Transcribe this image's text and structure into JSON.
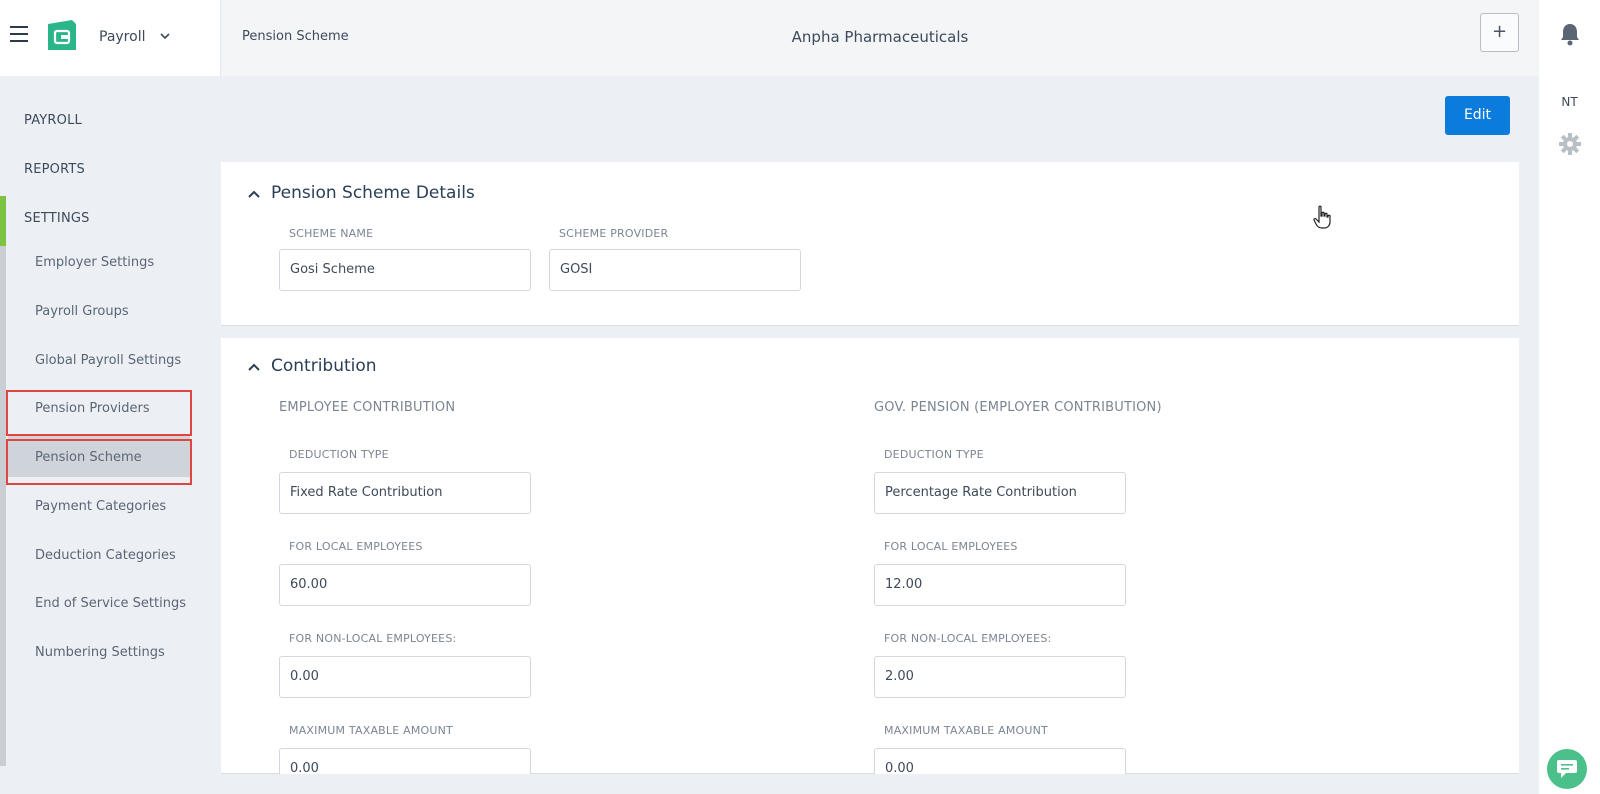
{
  "header": {
    "app_name": "Payroll",
    "breadcrumb": "Pension Scheme",
    "company": "Anpha Pharmaceuticals",
    "add_label": "+",
    "user_initials": "NT"
  },
  "sidebar": {
    "top_items": [
      {
        "label": "PAYROLL"
      },
      {
        "label": "REPORTS"
      },
      {
        "label": "SETTINGS"
      }
    ],
    "settings_items": [
      {
        "label": "Employer Settings"
      },
      {
        "label": "Payroll Groups"
      },
      {
        "label": "Global Payroll Settings"
      },
      {
        "label": "Pension Providers"
      },
      {
        "label": "Pension Scheme"
      },
      {
        "label": "Payment Categories"
      },
      {
        "label": "Deduction Categories"
      },
      {
        "label": "End of Service Settings"
      },
      {
        "label": "Numbering Settings"
      }
    ],
    "active_item": "Pension Scheme"
  },
  "actions": {
    "edit_label": "Edit"
  },
  "details": {
    "title": "Pension Scheme Details",
    "scheme_name_label": "SCHEME NAME",
    "scheme_name_value": "Gosi Scheme",
    "scheme_provider_label": "SCHEME PROVIDER",
    "scheme_provider_value": "GOSI"
  },
  "contribution": {
    "title": "Contribution",
    "employee": {
      "heading": "EMPLOYEE CONTRIBUTION",
      "deduction_type_label": "DEDUCTION TYPE",
      "deduction_type_value": "Fixed Rate Contribution",
      "local_label": "FOR LOCAL EMPLOYEES",
      "local_value": "60.00",
      "nonlocal_label": "FOR NON-LOCAL EMPLOYEES:",
      "nonlocal_value": "0.00",
      "max_label": "MAXIMUM TAXABLE AMOUNT",
      "max_value": "0.00"
    },
    "employer": {
      "heading": "GOV. PENSION (EMPLOYER CONTRIBUTION)",
      "deduction_type_label": "DEDUCTION TYPE",
      "deduction_type_value": "Percentage Rate Contribution",
      "local_label": "FOR LOCAL EMPLOYEES",
      "local_value": "12.00",
      "nonlocal_label": "FOR NON-LOCAL EMPLOYEES:",
      "nonlocal_value": "2.00",
      "max_label": "MAXIMUM TAXABLE AMOUNT",
      "max_value": "0.00"
    }
  },
  "colors": {
    "brand_green": "#2bb58a",
    "edit_blue": "#0b7bdc",
    "settings_accent": "#7cc243",
    "highlight_red": "#e0463f"
  }
}
